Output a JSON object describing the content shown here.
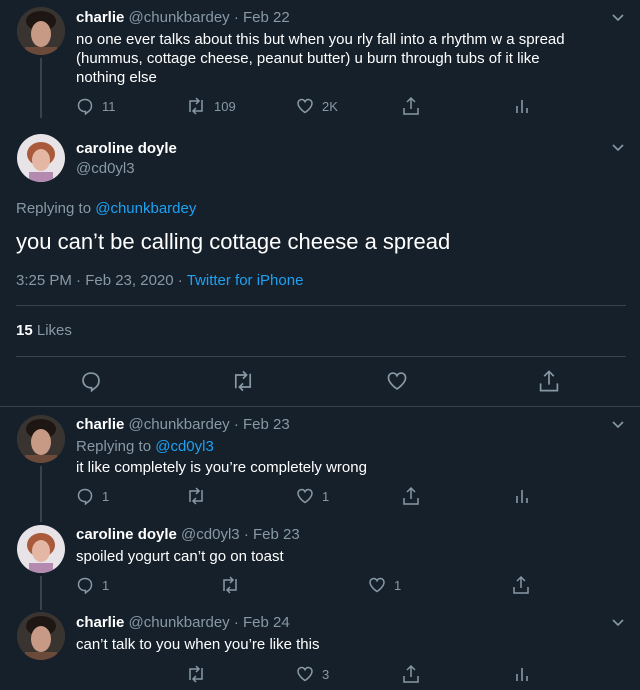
{
  "tweets": [
    {
      "name": "charlie",
      "handle": "@chunkbardey",
      "date": "Feb 22",
      "text_lines": [
        "no one ever talks about this but when you rly fall into a rhythm w a spread",
        "(hummus, cottage cheese, peanut butter) u burn through tubs of it like",
        "nothing else"
      ],
      "replies": "11",
      "retweets": "109",
      "likes": "2K"
    },
    {
      "name": "charlie",
      "handle": "@chunkbardey",
      "date": "Feb 23",
      "replying_label": "Replying to",
      "replying_to": "@cd0yl3",
      "text": "it like completely is you’re completely wrong",
      "replies": "1",
      "likes": "1"
    },
    {
      "name": "caroline doyle",
      "handle": "@cd0yl3",
      "date": "Feb 23",
      "text": "spoiled yogurt can’t go on toast",
      "replies": "1",
      "likes": "1"
    },
    {
      "name": "charlie",
      "handle": "@chunkbardey",
      "date": "Feb 24",
      "text": "can’t talk to you when you’re like this",
      "likes": "3"
    }
  ],
  "main": {
    "name": "caroline doyle",
    "handle": "@cd0yl3",
    "replying_label": "Replying to",
    "replying_to": "@chunkbardey",
    "text": "you can’t be calling cottage cheese a spread",
    "time": "3:25 PM · Feb 23, 2020",
    "client": "Twitter for iPhone",
    "likes_count": "15",
    "likes_label": "Likes"
  },
  "separator": "·",
  "icons": [
    "reply-icon",
    "retweet-icon",
    "like-icon",
    "share-icon",
    "analytics-icon",
    "chevron-down-icon"
  ],
  "colors": {
    "background": "#15202b",
    "accent": "#1da1f2",
    "muted": "#8899a6",
    "divider": "#38444d"
  }
}
